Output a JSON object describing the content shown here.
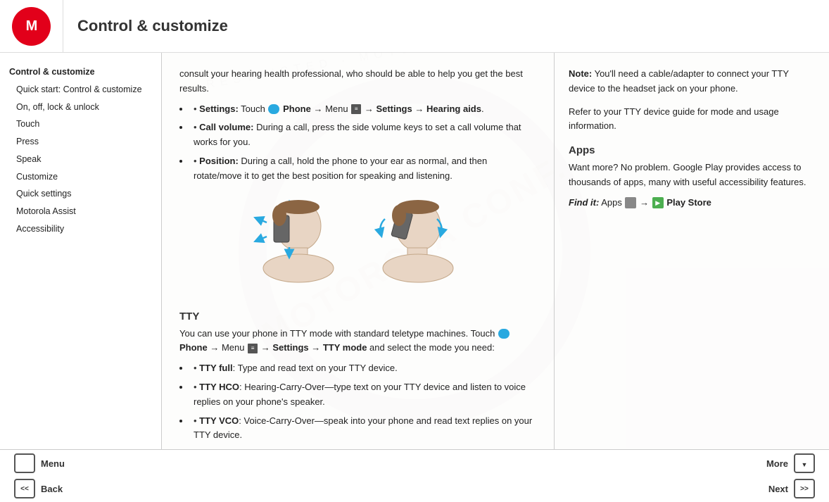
{
  "header": {
    "title": "Control & customize",
    "logo_letter": "M"
  },
  "sidebar": {
    "items": [
      {
        "label": "Control & customize",
        "bold": true,
        "indented": false
      },
      {
        "label": "Quick start: Control & customize",
        "bold": false,
        "indented": true
      },
      {
        "label": "On, off, lock & unlock",
        "bold": false,
        "indented": true
      },
      {
        "label": "Touch",
        "bold": false,
        "indented": true
      },
      {
        "label": "Press",
        "bold": false,
        "indented": true
      },
      {
        "label": "Speak",
        "bold": false,
        "indented": true
      },
      {
        "label": "Customize",
        "bold": false,
        "indented": true
      },
      {
        "label": "Quick settings",
        "bold": false,
        "indented": true
      },
      {
        "label": "Motorola Assist",
        "bold": false,
        "indented": true
      },
      {
        "label": "Accessibility",
        "bold": false,
        "indented": true
      }
    ]
  },
  "main_content": {
    "intro_text": "consult your hearing health professional, who should be able to help you get the best results.",
    "bullets": [
      {
        "label": "Settings:",
        "text": " Touch  Phone → Menu  → Settings → Hearing aids."
      },
      {
        "label": "Call volume:",
        "text": " During a call, press the side volume keys to set a call volume that works for you."
      },
      {
        "label": "Position:",
        "text": " During a call, hold the phone to your ear as normal, and then rotate/move it to get the best position for speaking and listening."
      }
    ],
    "tty_section": {
      "title": "TTY",
      "intro": "You can use your phone in TTY mode with standard teletype machines. Touch  Phone → Menu  → Settings → TTY mode and select the mode you need:",
      "tty_bullets": [
        {
          "label": "TTY full",
          "text": ": Type and read text on your TTY device."
        },
        {
          "label": "TTY HCO",
          "text": ": Hearing-Carry-Over—type text on your TTY device and listen to voice replies on your phone's speaker."
        },
        {
          "label": "TTY VCO",
          "text": ": Voice-Carry-Over—speak into your phone and read text replies on your TTY device."
        }
      ]
    }
  },
  "right_panel": {
    "note_label": "Note:",
    "note_text": " You'll need a cable/adapter to connect your TTY device to the headset jack on your phone.",
    "refer_text": "Refer to your TTY device guide for mode and usage information.",
    "apps_title": "Apps",
    "apps_text": "Want more? No problem. Google Play provides access to thousands of apps, many with useful accessibility features.",
    "find_label": "Find it:",
    "find_text": " Apps  →  Play Store"
  },
  "bottom_bar": {
    "menu_label": "Menu",
    "back_label": "Back",
    "more_label": "More",
    "next_label": "Next"
  }
}
